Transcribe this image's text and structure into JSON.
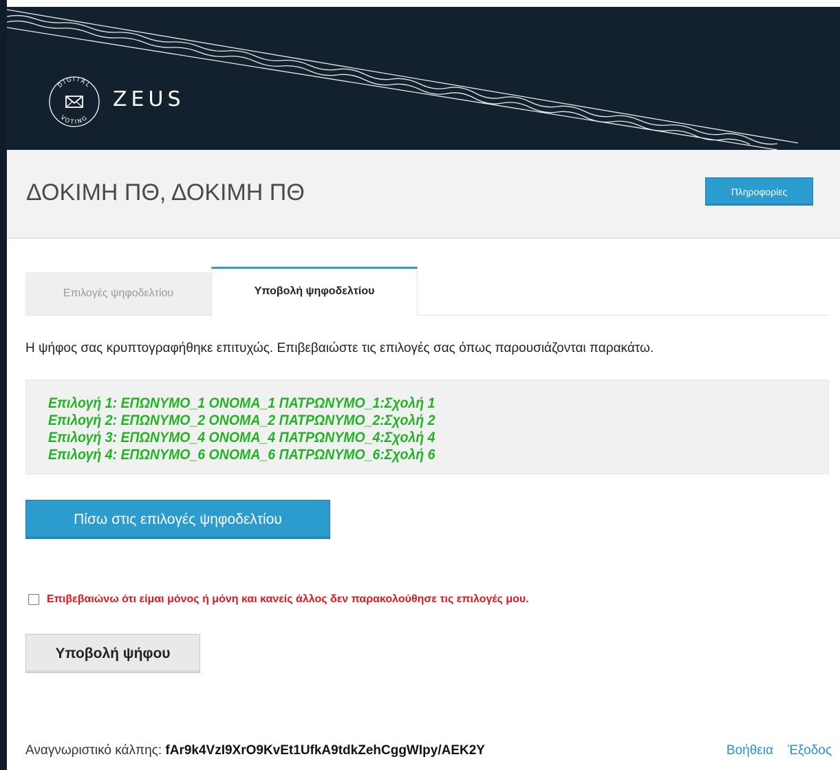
{
  "header": {
    "logo_text": "ZEUS",
    "logo_ring_top": "DIGITAL",
    "logo_ring_bottom": "VOTING",
    "background_color": "#13202d"
  },
  "title_bar": {
    "title": "ΔΟΚΙΜΗ ΠΘ, ΔΟΚΙΜΗ ΠΘ",
    "info_button": "Πληροφορίες"
  },
  "tabs": [
    {
      "label": "Επιλογές ψηφοδελτίου",
      "active": false
    },
    {
      "label": "Υποβολή ψηφοδελτίου",
      "active": true
    }
  ],
  "status_message": "Η ψήφος σας κρυπτογραφήθηκε επιτυχώς. Επιβεβαιώστε τις επιλογές σας όπως παρουσιάζονται παρακάτω.",
  "choices": [
    "Επιλογή 1: ΕΠΩΝΥΜΟ_1 ΟΝΟΜΑ_1 ΠΑΤΡΩΝΥΜΟ_1:Σχολή 1",
    "Επιλογή 2: ΕΠΩΝΥΜΟ_2 ΟΝΟΜΑ_2 ΠΑΤΡΩΝΥΜΟ_2:Σχολή 2",
    "Επιλογή 3: ΕΠΩΝΥΜΟ_4 ΟΝΟΜΑ_4 ΠΑΤΡΩΝΥΜΟ_4:Σχολή 4",
    "Επιλογή 4: ΕΠΩΝΥΜΟ_6 ΟΝΟΜΑ_6 ΠΑΤΡΩΝΥΜΟ_6:Σχολή 6"
  ],
  "back_button": "Πίσω στις επιλογές ψηφοδελτίου",
  "confirm": {
    "checked": false,
    "label": "Επιβεβαιώνω ότι είμαι μόνος ή μόνη και κανείς άλλος δεν παρακολούθησε τις επιλογές μου."
  },
  "submit_button": "Υποβολή ψήφου",
  "footer": {
    "ballot_id_label": "Αναγνωριστικό κάλπης:",
    "ballot_id": "fAr9k4VzI9XrO9KvEt1UfkA9tdkZehCggWIpy/AEK2Y",
    "help_link": "Βοήθεια",
    "logout_link": "Έξοδος"
  },
  "colors": {
    "accent": "#2c9ccf",
    "choice_text": "#22b324",
    "warning_text": "#e0171b"
  }
}
